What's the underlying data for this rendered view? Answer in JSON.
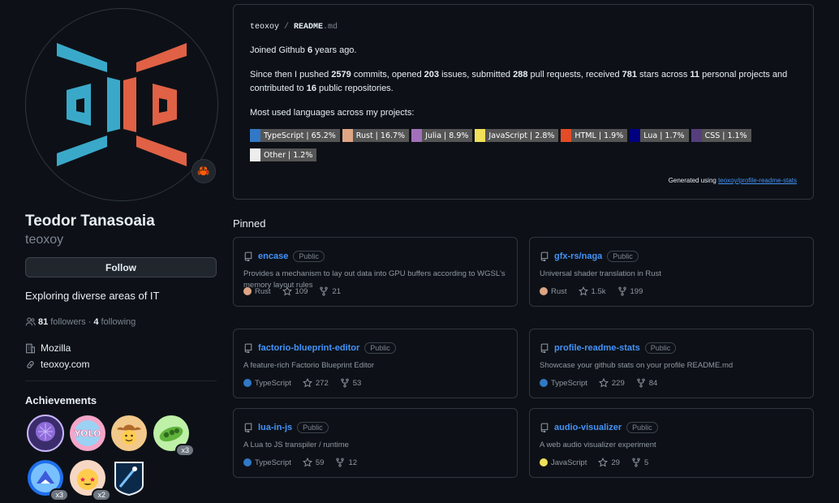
{
  "profile": {
    "full_name": "Teodor Tanasoaia",
    "login": "teoxoy",
    "follow_label": "Follow",
    "bio": "Exploring diverse areas of IT",
    "followers_count": "81",
    "followers_label": "followers",
    "separator": "·",
    "following_count": "4",
    "following_label": "following",
    "company": "Mozilla",
    "website": "teoxoy.com",
    "status_emoji": "🦀"
  },
  "achievements": {
    "title": "Achievements",
    "badges": [
      {
        "name": "badge-1",
        "count": ""
      },
      {
        "name": "badge-2",
        "count": ""
      },
      {
        "name": "badge-3",
        "count": ""
      },
      {
        "name": "badge-4",
        "count": "x3"
      },
      {
        "name": "badge-5",
        "count": "x3"
      },
      {
        "name": "badge-6",
        "count": "x2"
      },
      {
        "name": "badge-7",
        "count": ""
      }
    ]
  },
  "readme": {
    "user": "teoxoy",
    "sep": " / ",
    "file": "README",
    "ext": ".md",
    "joined_pre": "Joined Github ",
    "joined_years": "6",
    "joined_post": " years ago.",
    "stats": {
      "p1": "Since then I pushed ",
      "commits": "2579",
      "p2": " commits, opened ",
      "issues": "203",
      "p3": " issues, submitted ",
      "prs": "288",
      "p4": " pull requests, received ",
      "stars": "781",
      "p5": " stars across ",
      "projects": "11",
      "p6": " personal projects and contributed to ",
      "contrib": "16",
      "p7": " public repositories."
    },
    "languages_heading": "Most used languages across my projects:",
    "languages": [
      {
        "label": "TypeScript | 65.2%",
        "color": "#3178c6"
      },
      {
        "label": "Rust | 16.7%",
        "color": "#dea584"
      },
      {
        "label": "Julia | 8.9%",
        "color": "#a270ba"
      },
      {
        "label": "JavaScript | 2.8%",
        "color": "#f1e05a"
      },
      {
        "label": "HTML | 1.9%",
        "color": "#e34c26"
      },
      {
        "label": "Lua | 1.7%",
        "color": "#000080"
      },
      {
        "label": "CSS | 1.1%",
        "color": "#563d7c"
      },
      {
        "label": "Other | 1.2%",
        "color": "#ededed"
      }
    ],
    "generated_pre": "Generated using ",
    "generated_link": "teoxoy/profile-readme-stats"
  },
  "pinned": {
    "title": "Pinned",
    "repos": [
      {
        "name": "encase",
        "visibility": "Public",
        "desc": "Provides a mechanism to lay out data into GPU buffers according to WGSL's memory layout rules",
        "lang": "Rust",
        "lang_color": "#dea584",
        "stars": "109",
        "forks": "21"
      },
      {
        "name": "gfx-rs/naga",
        "visibility": "Public",
        "desc": "Universal shader translation in Rust",
        "lang": "Rust",
        "lang_color": "#dea584",
        "stars": "1.5k",
        "forks": "199"
      },
      {
        "name": "factorio-blueprint-editor",
        "visibility": "Public",
        "desc": "A feature-rich Factorio Blueprint Editor",
        "lang": "TypeScript",
        "lang_color": "#3178c6",
        "stars": "272",
        "forks": "53"
      },
      {
        "name": "profile-readme-stats",
        "visibility": "Public",
        "desc": "Showcase your github stats on your profile README.md",
        "lang": "TypeScript",
        "lang_color": "#3178c6",
        "stars": "229",
        "forks": "84"
      },
      {
        "name": "lua-in-js",
        "visibility": "Public",
        "desc": "A Lua to JS transpiler / runtime",
        "lang": "TypeScript",
        "lang_color": "#3178c6",
        "stars": "59",
        "forks": "12"
      },
      {
        "name": "audio-visualizer",
        "visibility": "Public",
        "desc": "A web audio visualizer experiment",
        "lang": "JavaScript",
        "lang_color": "#f1e05a",
        "stars": "29",
        "forks": "5"
      }
    ]
  }
}
